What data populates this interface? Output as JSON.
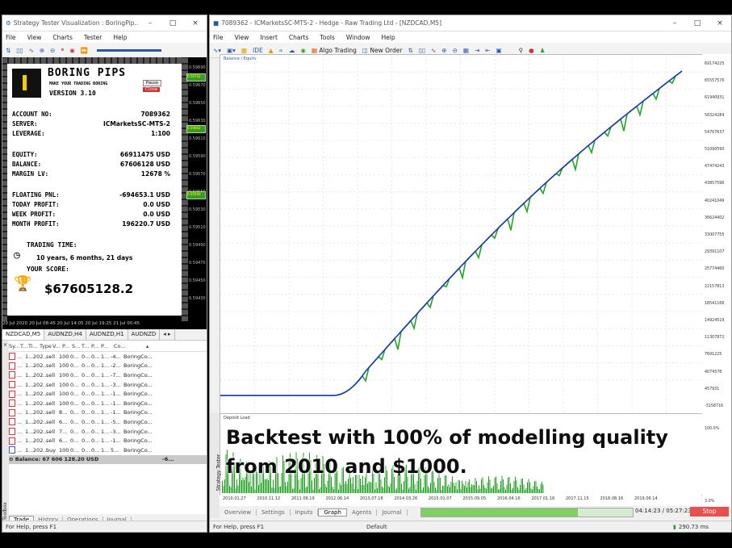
{
  "left_window": {
    "title": "Strategy Tester Visualization : BoringPip...",
    "menu": [
      "File",
      "View",
      "Charts",
      "Tester",
      "Help"
    ],
    "price_scale": [
      "0.59690",
      "0.59670",
      "0.59650",
      "0.59630",
      "0.59610",
      "0.59590",
      "0.59570",
      "0.59550",
      "0.59530",
      "0.59510",
      "0.59490",
      "0.59470",
      "0.59450",
      "0.59430"
    ],
    "price_badges": [
      "0.59702",
      "0.59662",
      "0.59590"
    ],
    "time_axis": "20 Jul 2020   20 Jul 08:45   20 Jul 14:05   20 Jul 19:25   21 Jul 00:45",
    "symbol_tabs": [
      "NZDCAD,M5",
      "AUDNZD,H4",
      "AUDNZD,H1",
      "AUDNZD",
      "◂ ▸"
    ],
    "ea": {
      "name": "BORING PIPS",
      "tagline": "MAKE YOUR TRADING BORING",
      "version": "VERSION 3.10",
      "pause": "Pause",
      "close": "Close",
      "account_label": "ACCOUNT NO:",
      "account_value": "7089362",
      "server_label": "SERVER:",
      "server_value": "ICMarketsSC-MTS-2",
      "leverage_label": "LEVERAGE:",
      "leverage_value": "1:100",
      "equity_label": "EQUITY:",
      "equity_value": "66911475 USD",
      "balance_label": "BALANCE:",
      "balance_value": "67606128 USD",
      "margin_label": "MARGIN LV:",
      "margin_value": "12678 %",
      "floating_label": "FLOATING PNL:",
      "floating_value": "-694653.1 USD",
      "today_label": "TODAY PROFIT:",
      "today_value": "0.0 USD",
      "week_label": "WEEK PROFIT:",
      "week_value": "0.0 USD",
      "month_label": "MONTH PROFIT:",
      "month_value": "196220.7 USD",
      "trading_time_label": "TRADING TIME:",
      "trading_time_value": "10 years, 6 months, 21 days",
      "score_label": "YOUR SCORE:",
      "score_value": "$67605128.2"
    },
    "trade_headers": [
      "Sy...",
      "T...",
      "Ti...",
      "Type",
      "V...",
      "P...",
      "S...",
      "T...",
      "P...",
      "P...",
      "Co...",
      "▴"
    ],
    "trades": [
      {
        "type": "sell",
        "vol": "100",
        "p": "-4...",
        "comment": "BoringCo..."
      },
      {
        "type": "sell",
        "vol": "100",
        "p": "-2...",
        "comment": "BoringCo..."
      },
      {
        "type": "sell",
        "vol": "100",
        "p": "-7...",
        "comment": "BoringCo..."
      },
      {
        "type": "sell",
        "vol": "100",
        "p": "-3...",
        "comment": "BoringCo..."
      },
      {
        "type": "sell",
        "vol": "100",
        "p": "-1...",
        "comment": "BoringCo..."
      },
      {
        "type": "sell",
        "vol": "100",
        "p": "-1...",
        "comment": "BoringCo..."
      },
      {
        "type": "sell",
        "vol": "8...",
        "p": "-1...",
        "comment": "BoringCo..."
      },
      {
        "type": "sell",
        "vol": "6...",
        "p": "-5...",
        "comment": "BoringCo..."
      },
      {
        "type": "sell",
        "vol": "7...",
        "p": "-3...",
        "comment": "BoringCo..."
      },
      {
        "type": "sell",
        "vol": "6...",
        "p": "-1...",
        "comment": "BoringCo..."
      },
      {
        "type": "buy",
        "vol": "100",
        "p": "5...",
        "comment": "BoringCo..."
      }
    ],
    "trade_row_common": {
      "sym": "...",
      "t": "1...",
      "ti": "202...",
      "price": "0...",
      "s": "0...",
      "t2": "0...",
      "p2": "1..."
    },
    "balance_row": "⊖ Balance: 67 606 128.20 USD",
    "balance_row_profit": "-6...",
    "bottom_tabs": [
      "Trade",
      "History",
      "Operations",
      "Journal"
    ],
    "toolbox": "Toolbox",
    "status": "For Help, press F1"
  },
  "right_window": {
    "title": "7089362 - ICMarketsSC-MTS-2 - Hedge - Raw Trading Ltd - [NZDCAD,M5]",
    "menu": [
      "File",
      "View",
      "Insert",
      "Charts",
      "Tools",
      "Window",
      "Help"
    ],
    "toolbar": {
      "algo": "Algo Trading",
      "new_order": "New Order",
      "ide": "IDE"
    },
    "chart_label": "Balance / Equity",
    "deposit_label": "Deposit Load",
    "right_scale": [
      "69174225",
      "65557576",
      "61940931",
      "58324284",
      "54707637",
      "51090590",
      "47474243",
      "43857596",
      "40241049",
      "36624402",
      "33007755",
      "29391107",
      "25774460",
      "22157813",
      "18541166",
      "14924519",
      "11307872",
      "7691225",
      "4074578",
      "457931",
      "-3158716",
      "100.0%",
      "3.0%"
    ],
    "x_axis": [
      "2010.01.27",
      "2010.11.12",
      "2011.08.19",
      "2012.06.14",
      "2013.07.18",
      "2014.03.26",
      "2015.01.07",
      "2015.09.05",
      "2016.04.16",
      "2017.01.18",
      "2017.11.15",
      "2018.08.16",
      "2019.06.14"
    ],
    "strategy_tester": "Strategy Tester",
    "tabs": [
      "Overview",
      "Settings",
      "Inputs",
      "Graph",
      "Agents",
      "Journal"
    ],
    "active_tab": "Graph",
    "progress": 0.74,
    "progress_time": "04:14:23 / 05:27:23",
    "stop": "Stop",
    "status_left": "For Help, press F1",
    "status_mid": "Default",
    "status_right": "290.73 ms"
  },
  "overlay": {
    "line1": "Backtest with 100% of modelling quality",
    "line2": "from 2010 and $1000."
  },
  "colors": {
    "balance": "#1a3aa8",
    "equity": "#1fa81f",
    "accent": "#2a58a8",
    "stop": "#e84f4f"
  }
}
